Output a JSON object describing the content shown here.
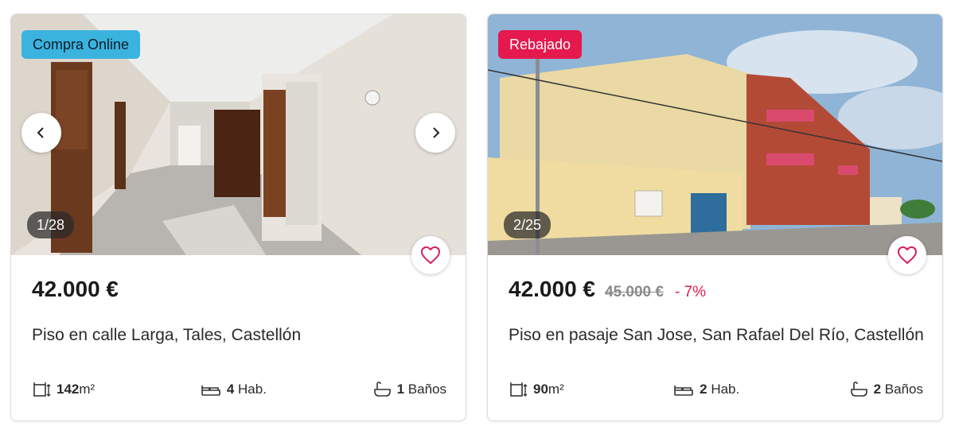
{
  "cards": [
    {
      "tag": "Compra Online",
      "counter": "1/28",
      "price": "42.000 €",
      "title": "Piso en calle Larga, Tales, Castellón",
      "area_value": "142",
      "area_unit": "m²",
      "rooms_value": "4",
      "rooms_label": "Hab.",
      "baths_value": "1",
      "baths_label": "Baños"
    },
    {
      "tag": "Rebajado",
      "counter": "2/25",
      "price": "42.000 €",
      "old_price": "45.000 €",
      "discount": "- 7%",
      "title": "Piso en pasaje San Jose, San Rafael Del Río, Castellón",
      "area_value": "90",
      "area_unit": "m²",
      "rooms_value": "2",
      "rooms_label": "Hab.",
      "baths_value": "2",
      "baths_label": "Baños"
    }
  ],
  "icons": {
    "prev": "chevron-left-icon",
    "next": "chevron-right-icon",
    "favorite": "heart-icon",
    "area": "area-icon",
    "rooms": "bed-icon",
    "baths": "bathtub-icon"
  },
  "colors": {
    "tag_online": "#3bb3df",
    "tag_discount": "#e5194e",
    "discount_text": "#e5194e",
    "heart": "#d81b60"
  }
}
